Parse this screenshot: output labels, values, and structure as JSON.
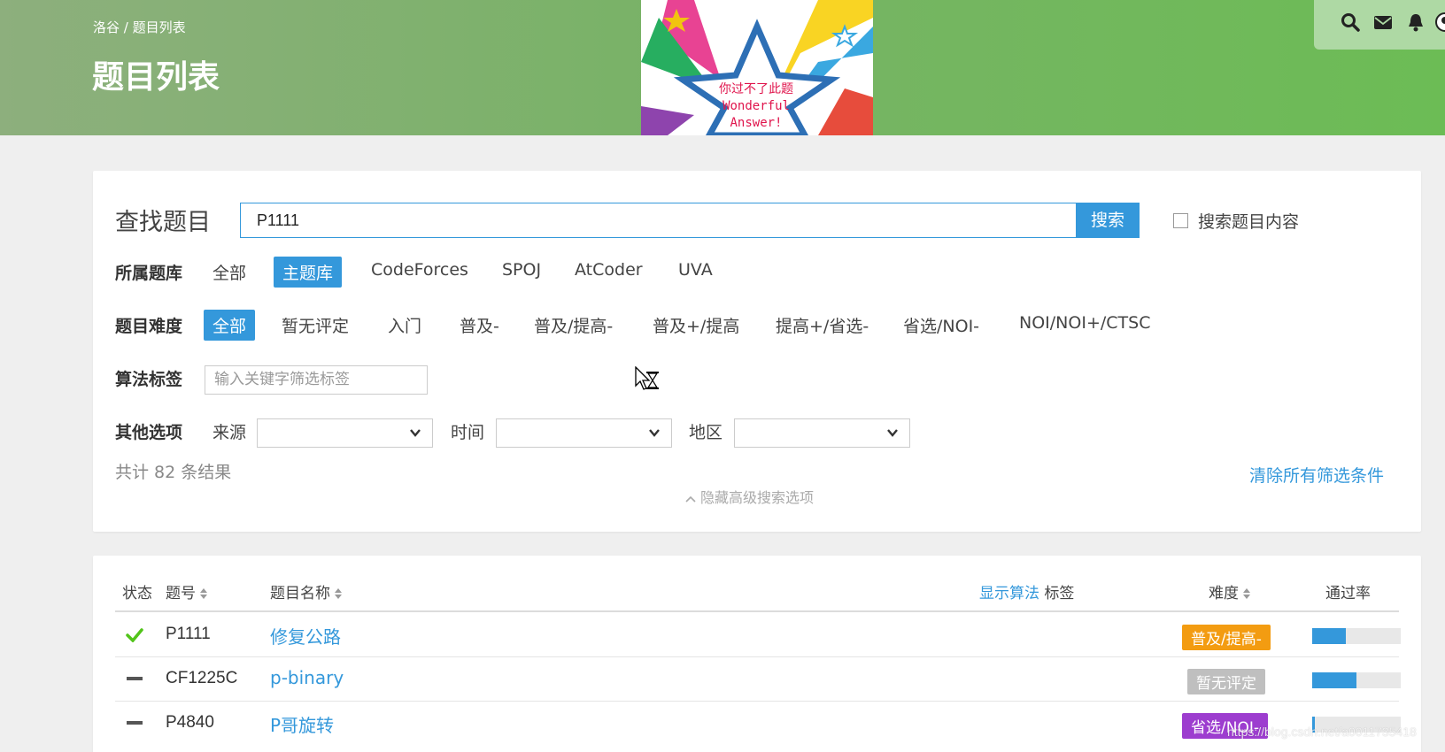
{
  "header": {
    "breadcrumb": "洛谷 / 题目列表",
    "title": "题目列表",
    "banner_line1": "你过不了此题",
    "banner_line2": "Wonderful",
    "banner_line3": "Answer!",
    "icons": [
      "search-icon",
      "mail-icon",
      "bell-icon",
      "avatar"
    ]
  },
  "search": {
    "label": "查找题目",
    "value": "P1111",
    "button": "搜索",
    "content_checkbox_label": "搜索题目内容"
  },
  "library": {
    "label": "所属题库",
    "options": [
      "全部",
      "主题库",
      "CodeForces",
      "SPOJ",
      "AtCoder",
      "UVA"
    ],
    "selected": "主题库"
  },
  "difficulty": {
    "label": "题目难度",
    "options": [
      "全部",
      "暂无评定",
      "入门",
      "普及-",
      "普及/提高-",
      "普及+/提高",
      "提高+/省选-",
      "省选/NOI-",
      "NOI/NOI+/CTSC"
    ],
    "selected": "全部"
  },
  "tags": {
    "label": "算法标签",
    "placeholder": "输入关键字筛选标签"
  },
  "other": {
    "label": "其他选项",
    "source_label": "来源",
    "time_label": "时间",
    "region_label": "地区"
  },
  "result_count": "共计 82 条结果",
  "clear_filters": "清除所有筛选条件",
  "hide_advanced": "隐藏高级搜索选项",
  "table": {
    "col_status": "状态",
    "col_id": "题号",
    "col_name": "题目名称",
    "show_tags_link": "显示算法",
    "col_tags": "标签",
    "col_difficulty": "难度",
    "col_passrate": "通过率",
    "rows": [
      {
        "status": "accepted",
        "id": "P1111",
        "name": "修复公路",
        "difficulty": "普及/提高-",
        "difficulty_color": "#f39c11",
        "passrate": 0.38
      },
      {
        "status": "none",
        "id": "CF1225C",
        "name": "p-binary",
        "difficulty": "暂无评定",
        "difficulty_color": "#bfbfbf",
        "passrate": 0.5
      },
      {
        "status": "none",
        "id": "P4840",
        "name": "P哥旋转",
        "difficulty": "省选/NOI-",
        "difficulty_color": "#9d3dcf",
        "passrate": 0.03
      }
    ]
  },
  "watermark": "https://blog.csdn.net/a0011735418",
  "colors": {
    "accent": "#3498db",
    "accepted": "#52c41a"
  }
}
